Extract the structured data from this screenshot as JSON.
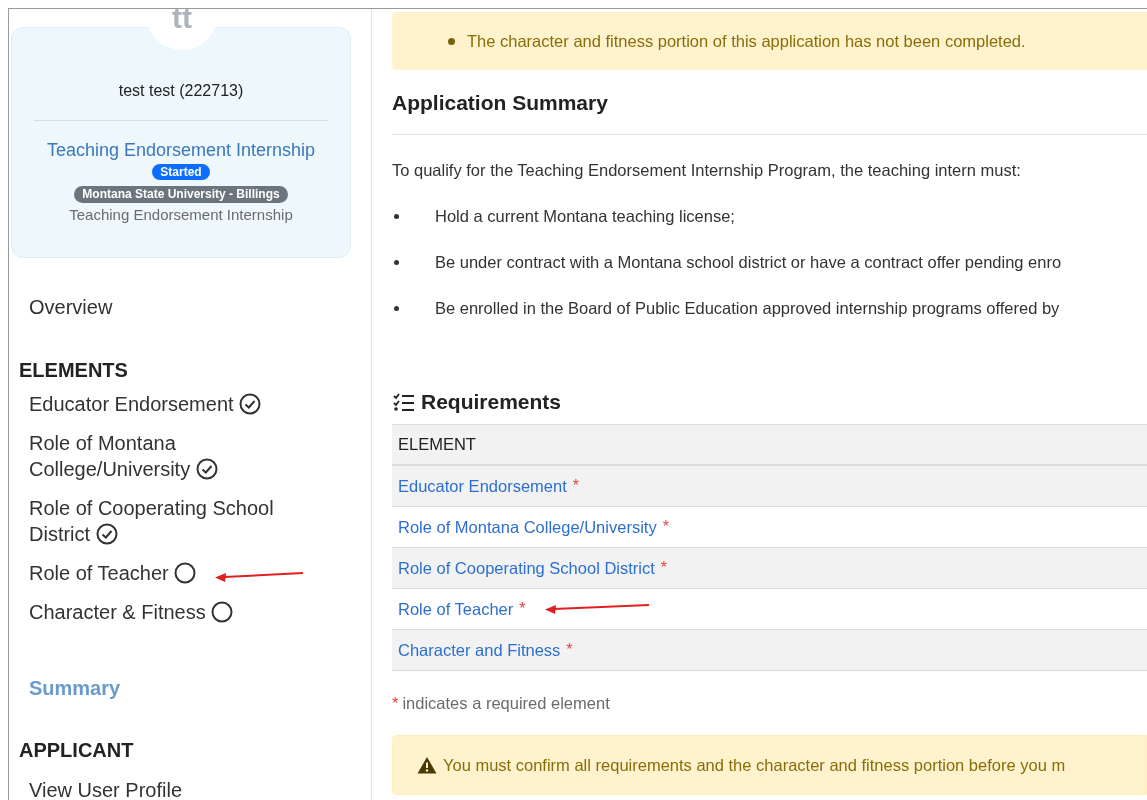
{
  "profile": {
    "avatar_initials": "tt",
    "name": "test test (222713)",
    "program": "Teaching Endorsement Internship",
    "status_badge": "Started",
    "institution_badge": "Montana State University - Billings",
    "subtitle": "Teaching Endorsement Internship"
  },
  "sidebar": {
    "overview": "Overview",
    "elements_heading": "ELEMENTS",
    "elements": [
      {
        "label": "Educator Endorsement",
        "done": true,
        "marked": false
      },
      {
        "label": "Role of Montana College/University",
        "done": true,
        "marked": false
      },
      {
        "label": "Role of Cooperating School District",
        "done": true,
        "marked": false
      },
      {
        "label": "Role of Teacher",
        "done": false,
        "marked": true
      },
      {
        "label": "Character & Fitness",
        "done": false,
        "marked": false
      }
    ],
    "summary": {
      "label": "Summary",
      "selected": true
    },
    "applicant_heading": "APPLICANT",
    "applicant_items": [
      "View User Profile"
    ]
  },
  "top_alert": {
    "items": [
      "The character and fitness portion of this application has not been completed."
    ]
  },
  "summary": {
    "title": "Application Summary",
    "intro": "To qualify for the Teaching Endorsement Internship Program, the teaching intern must:",
    "bullets": [
      "Hold a current Montana teaching license;",
      "Be under contract with a Montana school district or have a contract offer pending enro",
      "Be enrolled in the Board of Public Education approved internship programs offered by"
    ]
  },
  "requirements": {
    "title": "Requirements",
    "columns": [
      "ELEMENT"
    ],
    "rows": [
      {
        "label": "Educator Endorsement",
        "required": true,
        "marked": false
      },
      {
        "label": "Role of Montana College/University",
        "required": true,
        "marked": false
      },
      {
        "label": "Role of Cooperating School District",
        "required": true,
        "marked": false
      },
      {
        "label": "Role of Teacher",
        "required": true,
        "marked": true
      },
      {
        "label": "Character and Fitness",
        "required": true,
        "marked": false
      }
    ],
    "note_mark": "*",
    "note": "indicates a required element",
    "required_mark": "*"
  },
  "bottom_alert": {
    "text": "You must confirm all requirements and the character and fitness portion before you m"
  }
}
